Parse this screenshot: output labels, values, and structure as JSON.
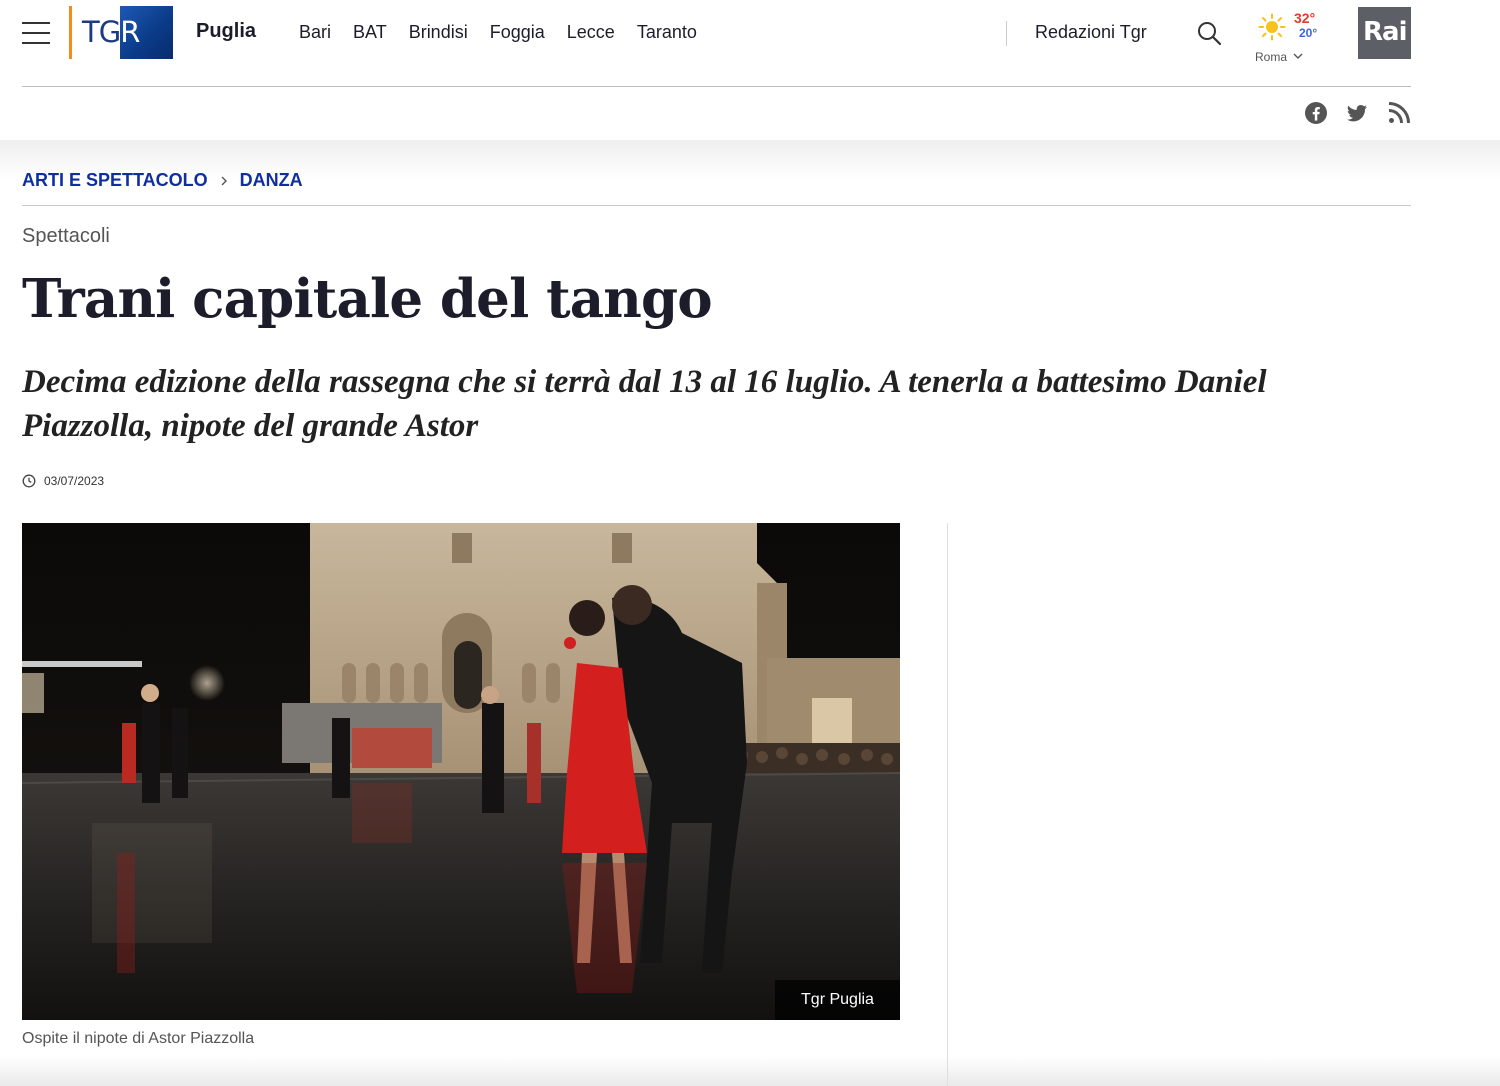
{
  "header": {
    "logo_text_gray": "TG",
    "logo_text_white": "R",
    "region": "Puglia",
    "cities": [
      "Bari",
      "BAT",
      "Brindisi",
      "Foggia",
      "Lecce",
      "Taranto"
    ],
    "redazioni": "Redazioni Tgr",
    "weather": {
      "max": "32°",
      "min": "20°",
      "city": "Roma",
      "icon": "sun-icon"
    },
    "rai_logo": "Rai",
    "social": [
      "facebook-icon",
      "twitter-icon",
      "rss-icon"
    ]
  },
  "breadcrumb": {
    "items": [
      "ARTI E SPETTACOLO",
      "DANZA"
    ]
  },
  "article": {
    "section": "Spettacoli",
    "title": "Trani capitale del tango",
    "subtitle": "Decima edizione della rassegna che si terrà dal 13 al 16 luglio. A tenerla a battesimo Daniel Piazzolla, nipote del grande Astor",
    "date": "03/07/2023",
    "media": {
      "credit": "Tgr Puglia",
      "caption": "Ospite il nipote di Astor Piazzolla"
    }
  },
  "colors": {
    "breadcrumb": "#0f2ea0",
    "temp_max": "#e43a2a",
    "temp_min": "#3a67d6",
    "logo_accent": "#f28c1b",
    "logo_box": "#0b3c8a",
    "rai_box": "#5c5f66"
  }
}
